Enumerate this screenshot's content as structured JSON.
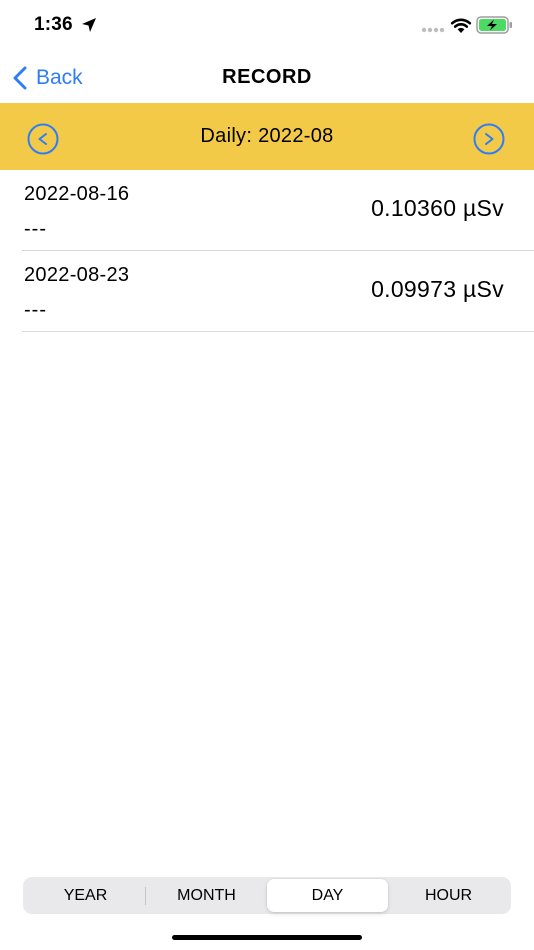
{
  "status_bar": {
    "time": "1:36"
  },
  "nav": {
    "back_label": "Back",
    "title": "RECORD"
  },
  "period": {
    "title": "Daily: 2022-08"
  },
  "records": [
    {
      "date": "2022-08-16",
      "note": "---",
      "value": "0.10360 µSv"
    },
    {
      "date": "2022-08-23",
      "note": "---",
      "value": "0.09973 µSv"
    }
  ],
  "segments": {
    "items": [
      "YEAR",
      "MONTH",
      "DAY",
      "HOUR"
    ],
    "selected": "DAY"
  },
  "colors": {
    "accent_blue": "#2f7df6",
    "header_yellow": "#f3ca47",
    "battery_green": "#4cd964"
  }
}
